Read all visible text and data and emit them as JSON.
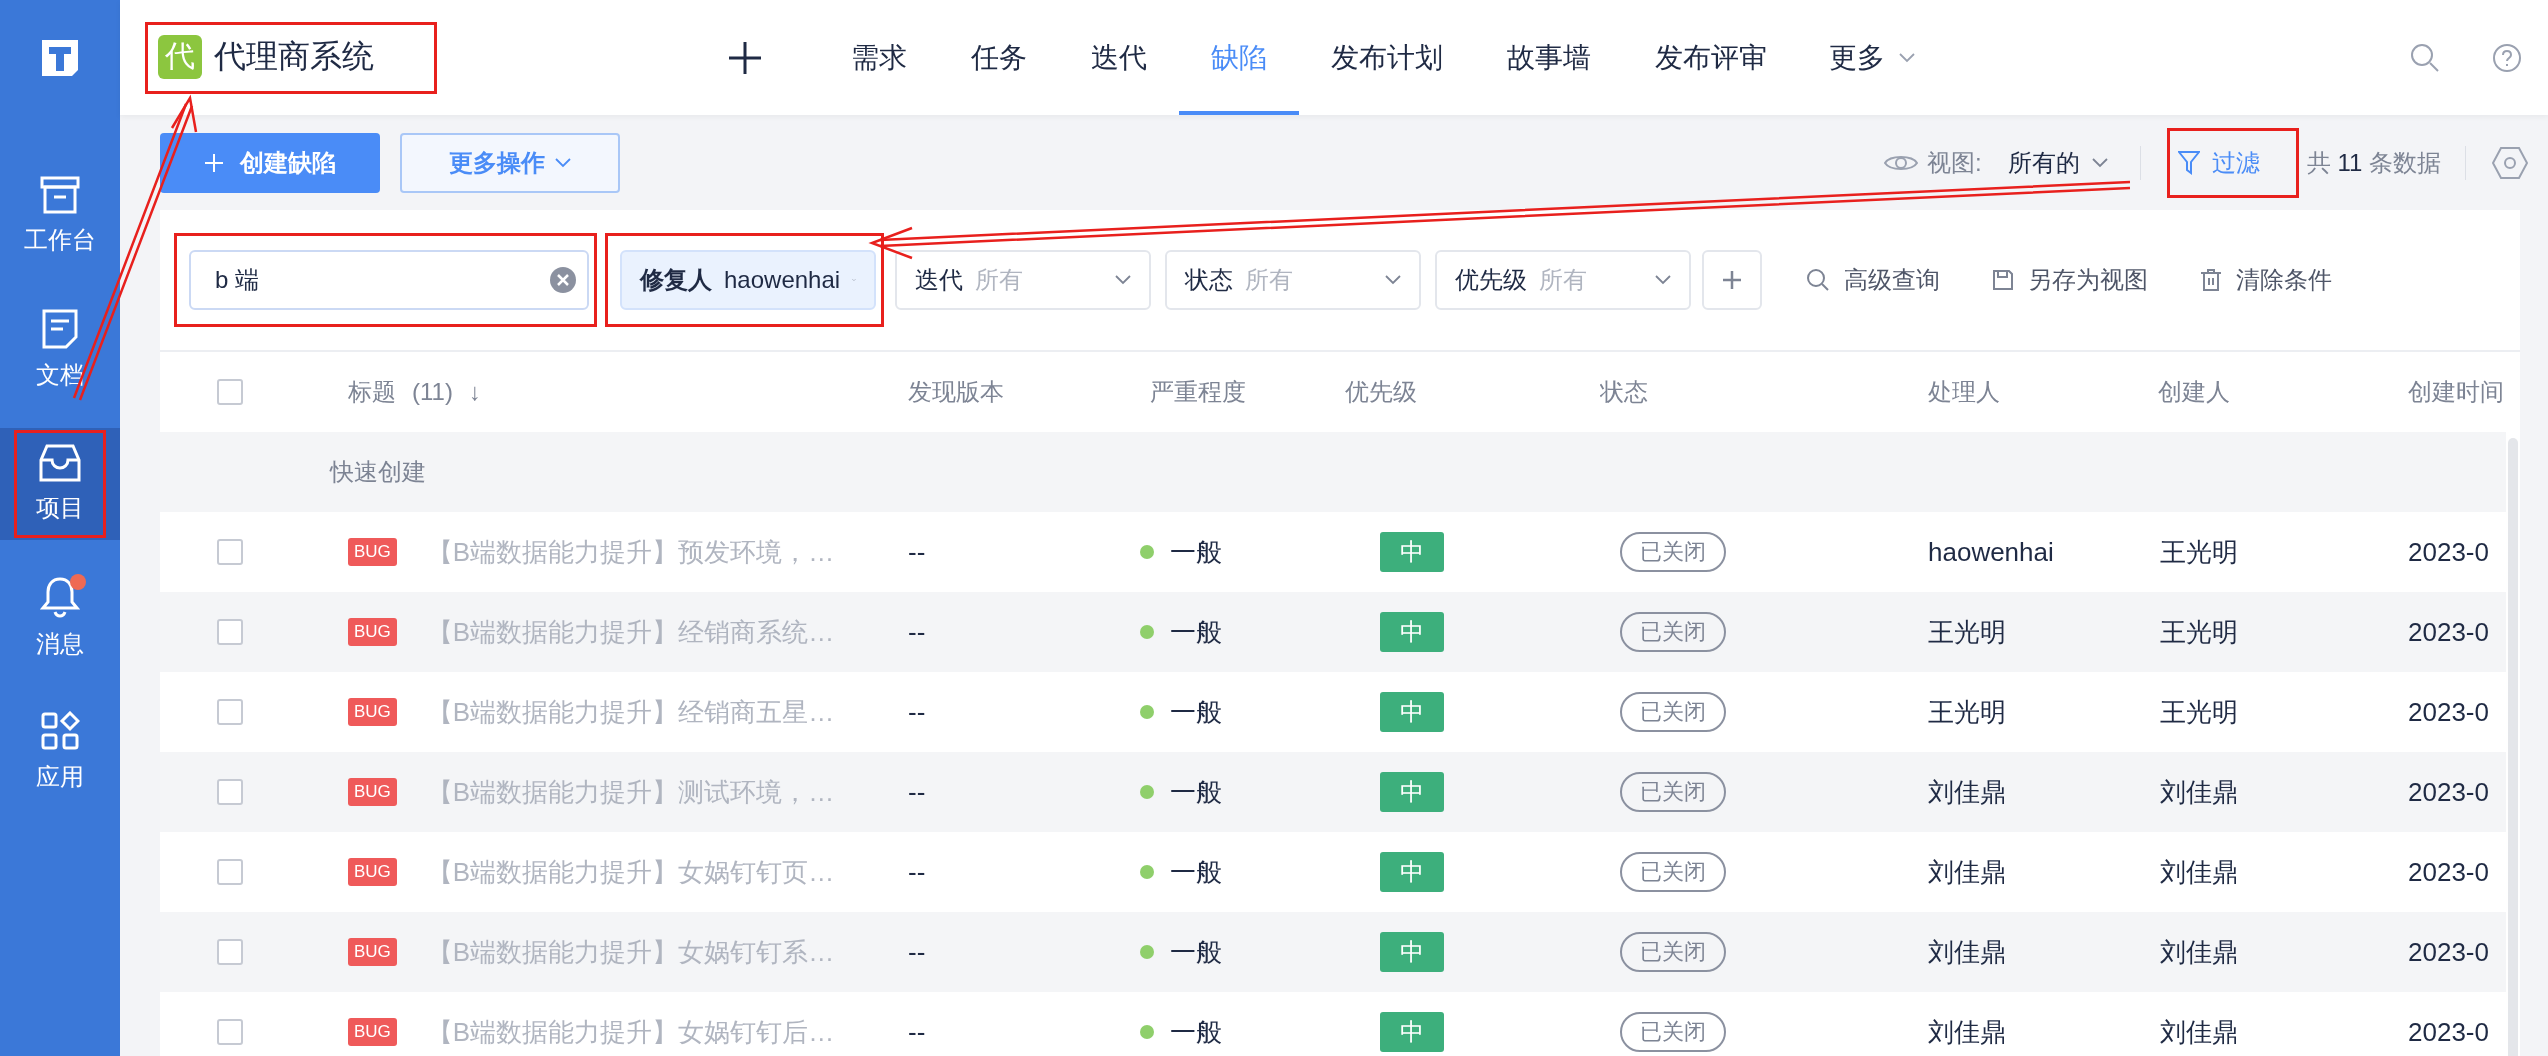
{
  "sidebar": {
    "items": [
      {
        "label": "工作台",
        "selected": false,
        "badge": false,
        "highlighted": false
      },
      {
        "label": "文档",
        "selected": false,
        "badge": false,
        "highlighted": false
      },
      {
        "label": "项目",
        "selected": true,
        "badge": false,
        "highlighted": true
      },
      {
        "label": "消息",
        "selected": false,
        "badge": true,
        "highlighted": false
      },
      {
        "label": "应用",
        "selected": false,
        "badge": false,
        "highlighted": false
      }
    ]
  },
  "project": {
    "badge": "代",
    "name": "代理商系统",
    "highlighted": true
  },
  "nav": {
    "tabs": [
      {
        "label": "需求",
        "selected": false
      },
      {
        "label": "任务",
        "selected": false
      },
      {
        "label": "迭代",
        "selected": false
      },
      {
        "label": "缺陷",
        "selected": true
      },
      {
        "label": "发布计划",
        "selected": false
      },
      {
        "label": "故事墙",
        "selected": false
      },
      {
        "label": "发布评审",
        "selected": false
      }
    ],
    "more": "更多"
  },
  "toolbar": {
    "create_button": "创建缺陷",
    "more_button": "更多操作",
    "view_label": "视图:",
    "view_value": "所有的",
    "filter_button": {
      "label": "过滤",
      "highlighted": true
    },
    "count": "共 **11** 条数据"
  },
  "filters": {
    "search": {
      "value": "b 端",
      "highlighted": true
    },
    "dropdowns": [
      {
        "label": "修复人",
        "value": "haowenhai",
        "active": true,
        "highlighted": true
      },
      {
        "label": "迭代",
        "value": "所有",
        "active": false,
        "highlighted": false
      },
      {
        "label": "状态",
        "value": "所有",
        "active": false,
        "highlighted": false
      },
      {
        "label": "优先级",
        "value": "所有",
        "active": false,
        "highlighted": false
      }
    ],
    "actions": [
      {
        "kind": "search",
        "label": "高级查询"
      },
      {
        "kind": "save",
        "label": "另存为视图"
      },
      {
        "kind": "clear",
        "label": "清除条件"
      }
    ]
  },
  "table": {
    "header_checked": false,
    "title_column": {
      "label": "标题",
      "count": "(11)",
      "sort": "↓"
    },
    "columns": [
      "发现版本",
      "严重程度",
      "优先级",
      "状态",
      "处理人",
      "创建人",
      "创建时间"
    ],
    "quick_create": "快速创建",
    "rows": [
      {
        "checked": false,
        "type": "BUG",
        "title": "【B端数据能力提升】预发环境，…",
        "version": "--",
        "severity": "一般",
        "color": "#8fcf6b",
        "priority": "中",
        "status": "已关闭",
        "assignee": "haowenhai",
        "creator": "王光明",
        "created": "2023-0"
      },
      {
        "checked": false,
        "type": "BUG",
        "title": "【B端数据能力提升】经销商系统…",
        "version": "--",
        "severity": "一般",
        "color": "#8fcf6b",
        "priority": "中",
        "status": "已关闭",
        "assignee": "王光明",
        "creator": "王光明",
        "created": "2023-0"
      },
      {
        "checked": false,
        "type": "BUG",
        "title": "【B端数据能力提升】经销商五星…",
        "version": "--",
        "severity": "一般",
        "color": "#8fcf6b",
        "priority": "中",
        "status": "已关闭",
        "assignee": "王光明",
        "creator": "王光明",
        "created": "2023-0"
      },
      {
        "checked": false,
        "type": "BUG",
        "title": "【B端数据能力提升】测试环境，…",
        "version": "--",
        "severity": "一般",
        "color": "#8fcf6b",
        "priority": "中",
        "status": "已关闭",
        "assignee": "刘佳鼎",
        "creator": "刘佳鼎",
        "created": "2023-0"
      },
      {
        "checked": false,
        "type": "BUG",
        "title": "【B端数据能力提升】女娲钉钉页…",
        "version": "--",
        "severity": "一般",
        "color": "#8fcf6b",
        "priority": "中",
        "status": "已关闭",
        "assignee": "刘佳鼎",
        "creator": "刘佳鼎",
        "created": "2023-0"
      },
      {
        "checked": false,
        "type": "BUG",
        "title": "【B端数据能力提升】女娲钉钉系…",
        "version": "--",
        "severity": "一般",
        "color": "#8fcf6b",
        "priority": "中",
        "status": "已关闭",
        "assignee": "刘佳鼎",
        "creator": "刘佳鼎",
        "created": "2023-0"
      },
      {
        "checked": false,
        "type": "BUG",
        "title": "【B端数据能力提升】女娲钉钉后…",
        "version": "--",
        "severity": "一般",
        "color": "#8fcf6b",
        "priority": "中",
        "status": "已关闭",
        "assignee": "刘佳鼎",
        "creator": "刘佳鼎",
        "created": "2023-0"
      }
    ]
  }
}
